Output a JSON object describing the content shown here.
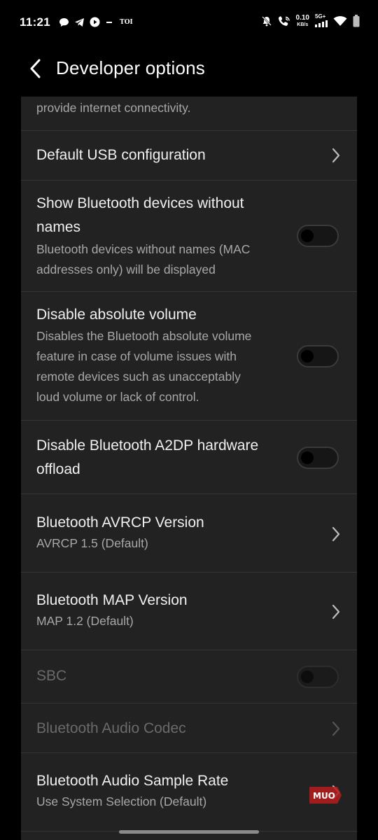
{
  "status_bar": {
    "time": "11:21",
    "carrier_tag": "TOI",
    "net_speed_value": "0.10",
    "net_speed_unit": "KB/s",
    "network_type": "5G+",
    "icons": [
      "chat-bubble-icon",
      "telegram-icon",
      "youtube-icon",
      "minus-icon",
      "mute-icon",
      "wifi-call-icon",
      "signal-icon",
      "wifi-icon",
      "battery-icon"
    ]
  },
  "header": {
    "title": "Developer options",
    "back_icon": "chevron-left-icon"
  },
  "settings": {
    "partial_top_text": "provide internet connectivity.",
    "items": [
      {
        "title": "Default USB configuration",
        "control": "chevron"
      },
      {
        "title_line1": "Show Bluetooth devices without",
        "title_line2": "names",
        "subtitle_line1": "Bluetooth devices without names (MAC",
        "subtitle_line2": "addresses only) will be displayed",
        "control": "toggle",
        "checked": false
      },
      {
        "title": "Disable absolute volume",
        "subtitle_line1": "Disables the Bluetooth absolute volume",
        "subtitle_line2": "feature in case of volume issues with",
        "subtitle_line3": "remote devices such as unacceptably",
        "subtitle_line4": "loud volume or lack of control.",
        "control": "toggle",
        "checked": false
      },
      {
        "title_line1": "Disable Bluetooth A2DP hardware",
        "title_line2": "offload",
        "control": "toggle",
        "checked": false
      },
      {
        "title": "Bluetooth AVRCP Version",
        "subtitle": "AVRCP 1.5 (Default)",
        "control": "chevron"
      },
      {
        "title": "Bluetooth MAP Version",
        "subtitle": "MAP 1.2 (Default)",
        "control": "chevron"
      },
      {
        "title": "SBC",
        "control": "toggle",
        "checked": false,
        "enabled": false
      },
      {
        "title": "Bluetooth Audio Codec",
        "control": "chevron",
        "enabled": false
      },
      {
        "title": "Bluetooth Audio Sample Rate",
        "subtitle": "Use System Selection (Default)",
        "control": "chevron"
      }
    ]
  },
  "watermark": "MUO",
  "colors": {
    "background": "#000000",
    "card": "#222222",
    "divider": "#353535",
    "title_text": "#f0f0f0",
    "subtitle_text": "#a8a8a8",
    "disabled_text": "#6a6a6a",
    "watermark": "#c62828"
  }
}
